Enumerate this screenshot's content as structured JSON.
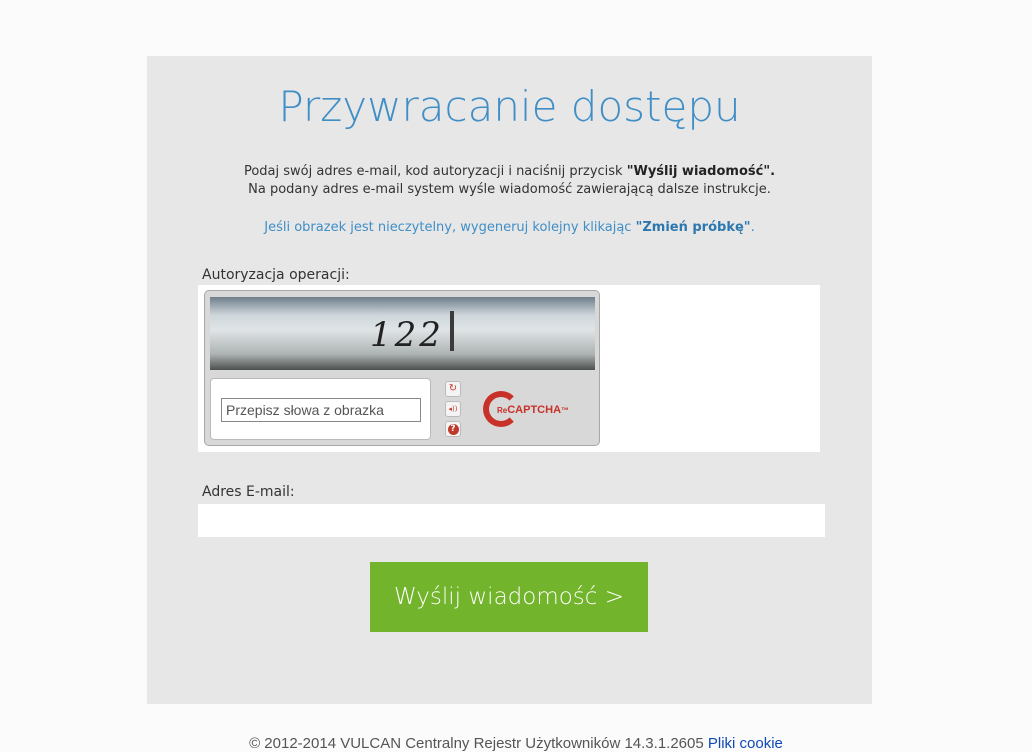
{
  "page": {
    "title": "Przywracanie dostępu",
    "intro_line1_prefix": "Podaj swój adres e-mail, kod autoryzacji i naciśnij przycisk ",
    "intro_line1_bold": "\"Wyślij wiadomość\".",
    "intro_line2": "Na podany adres e-mail system wyśle wiadomość zawierającą dalsze instrukcje.",
    "hint_prefix": "Jeśli obrazek jest nieczytelny, wygeneruj kolejny klikając ",
    "hint_bold": "\"Zmień próbkę\"",
    "hint_suffix": "."
  },
  "captcha": {
    "label": "Autoryzacja operacji:",
    "image_text": "122",
    "placeholder": "Przepisz słowa z obrazka",
    "refresh_icon": "↻",
    "audio_icon": "◂))",
    "help_icon": "?",
    "logo_prefix": "Re",
    "logo_word": "CAPTCHA",
    "logo_tm": "™"
  },
  "email": {
    "label": "Adres E-mail:",
    "value": ""
  },
  "submit": {
    "label": "Wyślij wiadomość >"
  },
  "footer": {
    "text": "© 2012-2014 VULCAN Centralny Rejestr Użytkowników 14.3.1.2605 ",
    "link": "Pliki cookie"
  },
  "colors": {
    "accent_blue": "#3f8ec6",
    "button_green": "#72b42b",
    "panel_gray": "#e7e7e7",
    "recaptcha_red": "#c8302a"
  }
}
